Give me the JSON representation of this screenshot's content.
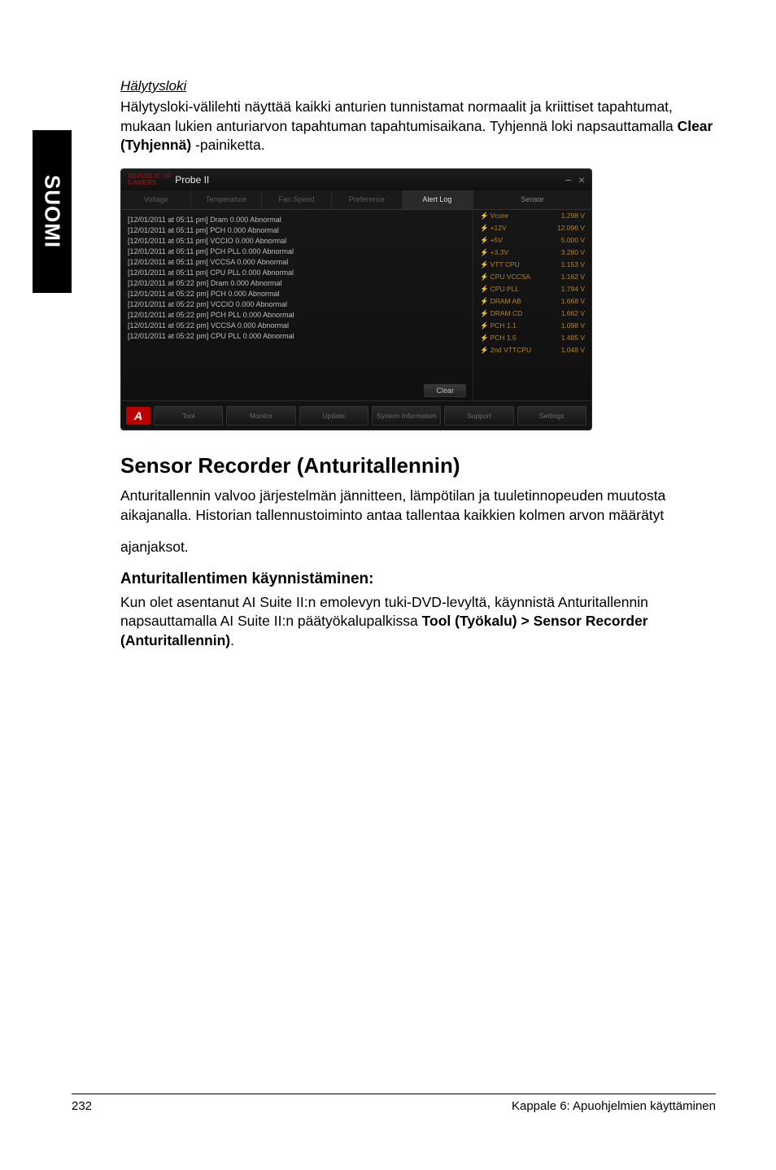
{
  "side_label": "SUOMI",
  "header": {
    "section_title": "Hälytysloki",
    "paragraph": "Hälytysloki-välilehti näyttää kaikki anturien tunnistamat normaalit ja kriittiset tapahtumat, mukaan lukien anturiarvon tapahtuman tapahtumisaikana. Tyhjennä loki napsauttamalla ",
    "clear_bold": "Clear (Tyhjennä)",
    "paragraph_tail": " -painiketta."
  },
  "screenshot": {
    "brand_top": "REPUBLIC OF",
    "brand_bottom": "GAMERS",
    "app_name": "Probe II",
    "minimize": "−",
    "close": "×",
    "tabs": [
      "Voltage",
      "Temperature",
      "Fan Speed",
      "Preference",
      "Alert Log"
    ],
    "active_tab_index": 4,
    "log_lines": [
      "[12/01/2011 at 05:11 pm] Dram 0.000 Abnormal",
      "[12/01/2011 at 05:11 pm] PCH 0.000 Abnormal",
      "[12/01/2011 at 05:11 pm] VCCIO 0.000 Abnormal",
      "[12/01/2011 at 05:11 pm] PCH PLL 0.000 Abnormal",
      "[12/01/2011 at 05:11 pm] VCCSA 0.000 Abnormal",
      "[12/01/2011 at 05:11 pm] CPU PLL 0.000 Abnormal",
      "[12/01/2011 at 05:22 pm] Dram 0.000 Abnormal",
      "[12/01/2011 at 05:22 pm] PCH 0.000 Abnormal",
      "[12/01/2011 at 05:22 pm] VCCIO 0.000 Abnormal",
      "[12/01/2011 at 05:22 pm] PCH PLL 0.000 Abnormal",
      "[12/01/2011 at 05:22 pm] VCCSA 0.000 Abnormal",
      "[12/01/2011 at 05:22 pm] CPU PLL 0.000 Abnormal"
    ],
    "clear_label": "Clear",
    "sensor_header": "Sensor",
    "sensors": [
      {
        "name": "Vcore",
        "value": "1.298 V"
      },
      {
        "name": "+12V",
        "value": "12.096 V"
      },
      {
        "name": "+5V",
        "value": "5.000 V"
      },
      {
        "name": "+3.3V",
        "value": "3.280 V"
      },
      {
        "name": "VTT CPU",
        "value": "1.153 V"
      },
      {
        "name": "CPU VCCSA",
        "value": "1.162 V"
      },
      {
        "name": "CPU PLL",
        "value": "1.794 V"
      },
      {
        "name": "DRAM AB",
        "value": "1.668 V"
      },
      {
        "name": "DRAM CD",
        "value": "1.662 V"
      },
      {
        "name": "PCH 1.1",
        "value": "1.098 V"
      },
      {
        "name": "PCH 1.5",
        "value": "1.485 V"
      },
      {
        "name": "2nd VTTCPU",
        "value": "1.048 V"
      }
    ],
    "bottom_buttons": [
      "Tool",
      "Monitor",
      "Update",
      "System Information",
      "Support",
      "Settings"
    ]
  },
  "sensor_recorder": {
    "heading": "Sensor Recorder (Anturitallennin)",
    "para_text": "Anturitallennin valvoo järjestelmän jännitteen, lämpötilan ja tuuletinnopeuden muutosta aikajanalla. Historian tallennustoiminto antaa tallentaa kaikkien kolmen arvon määrätyt",
    "para_tail": "ajanjaksot.",
    "sub_heading": "Anturitallentimen käynnistäminen:",
    "para2_pre": "Kun olet asentanut AI Suite II:n emolevyn tuki-DVD-levyltä, käynnistä Anturitallennin napsauttamalla AI Suite II:n päätyökalupalkissa ",
    "para2_bold": "Tool (Työkalu) > Sensor Recorder (Anturitallennin)",
    "para2_post": "."
  },
  "footer": {
    "page": "232",
    "chapter": "Kappale 6: Apuohjelmien käyttäminen"
  }
}
